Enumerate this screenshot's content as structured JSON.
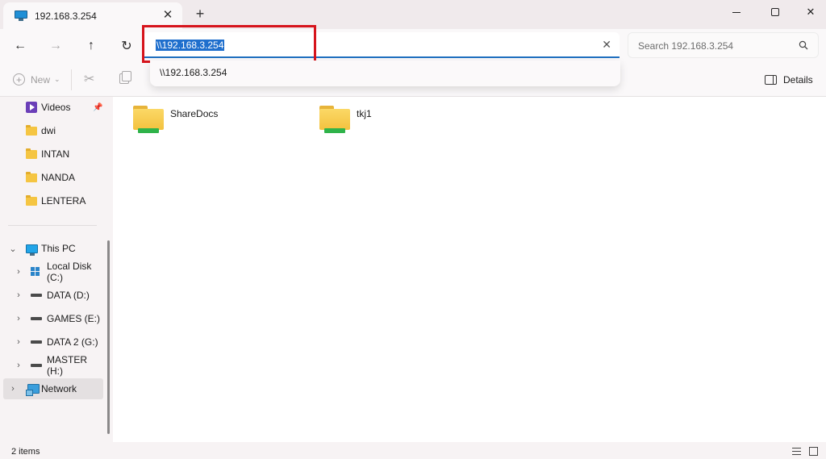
{
  "tab": {
    "title": "192.168.3.254",
    "close": "✕",
    "new_tab": "+"
  },
  "window": {
    "minimize": "",
    "maximize": "",
    "close": "✕"
  },
  "nav": {
    "back": "←",
    "forward": "→",
    "up": "↑",
    "refresh": "↻"
  },
  "address": {
    "value": "\\\\192.168.3.254",
    "clear": "✕"
  },
  "search": {
    "placeholder": "Search 192.168.3.254"
  },
  "suggestions": [
    {
      "label": "\\\\192.168.3.254"
    }
  ],
  "commands": {
    "new_label": "New",
    "new_plus": "+",
    "new_caret": "⌄",
    "cut": "✂",
    "details_label": "Details"
  },
  "sidebar": {
    "quick_access": [
      {
        "label": "Videos",
        "icon": "video-icon",
        "pinned": true
      },
      {
        "label": "dwi",
        "icon": "folder-icon"
      },
      {
        "label": "INTAN",
        "icon": "folder-icon"
      },
      {
        "label": "NANDA",
        "icon": "folder-icon"
      },
      {
        "label": "LENTERA",
        "icon": "folder-icon"
      }
    ],
    "pin": "📌",
    "this_pc": {
      "label": "This PC",
      "chevron": "⌄"
    },
    "drives": [
      {
        "label": "Local Disk (C:)",
        "icon": "windows-drive-icon"
      },
      {
        "label": "DATA (D:)",
        "icon": "drive-icon"
      },
      {
        "label": "GAMES (E:)",
        "icon": "drive-icon"
      },
      {
        "label": "DATA 2 (G:)",
        "icon": "drive-icon"
      },
      {
        "label": "MASTER (H:)",
        "icon": "drive-icon"
      }
    ],
    "network": {
      "label": "Network",
      "chevron": "›",
      "selected": true
    },
    "drive_chevron": "›"
  },
  "content": {
    "items": [
      {
        "label": "ShareDocs",
        "icon": "shared-folder-icon"
      },
      {
        "label": "tkj1",
        "icon": "shared-folder-icon"
      }
    ]
  },
  "status": {
    "item_count": "2 items"
  },
  "colors": {
    "accent": "#1f6fcd",
    "highlight_box": "#d6141c",
    "folder": "#f5c542",
    "share": "#2fb34a"
  }
}
